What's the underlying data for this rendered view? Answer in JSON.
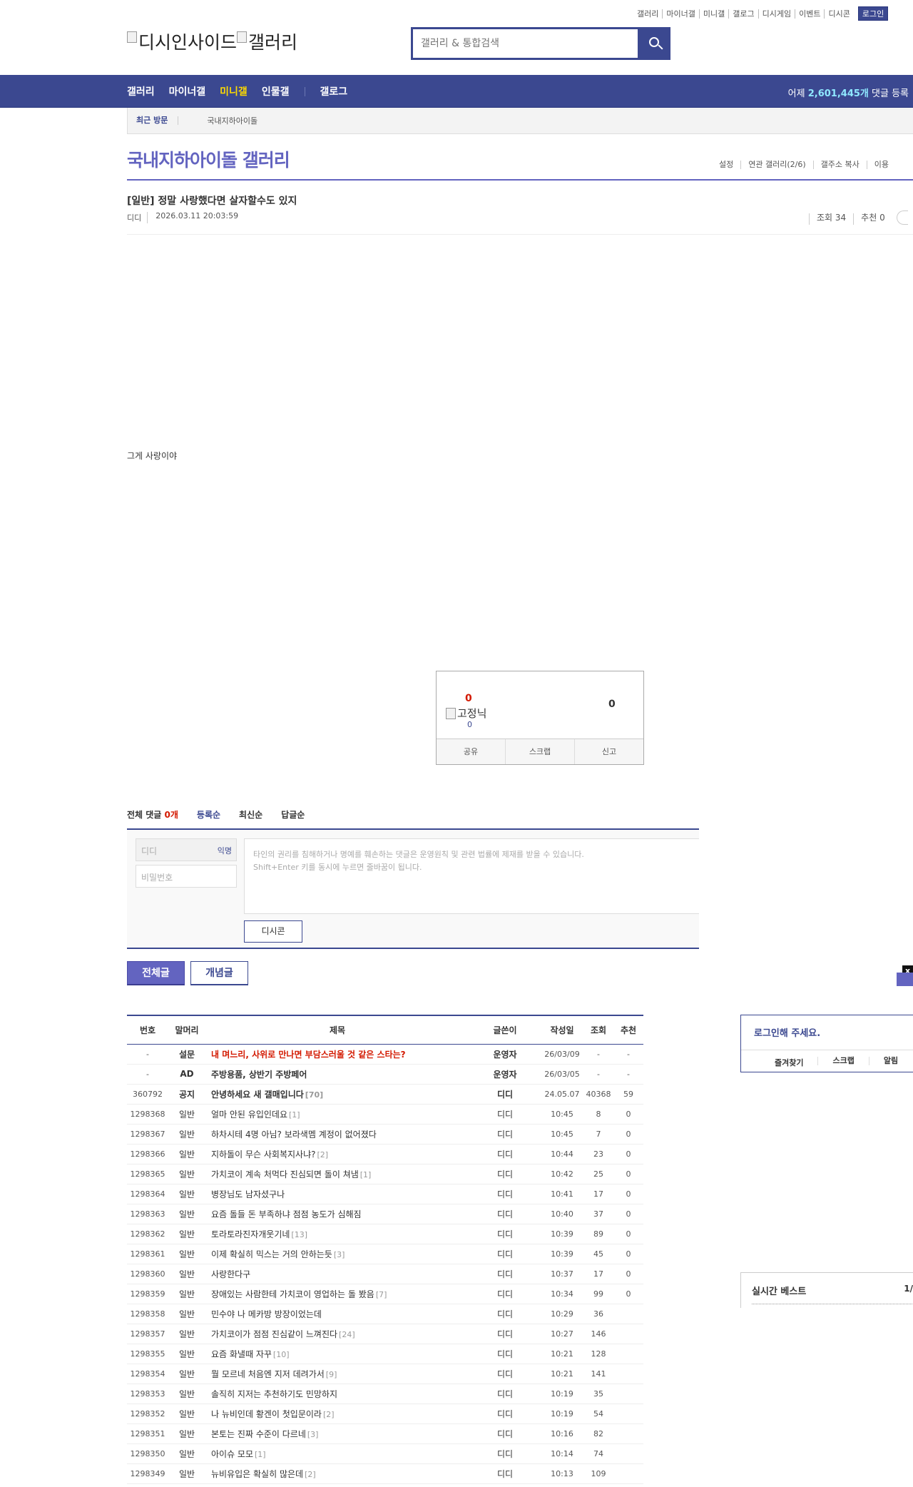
{
  "topnav": [
    "갤러리",
    "마이너갤",
    "미니갤",
    "갤로그",
    "디시게임",
    "이벤트",
    "디시콘"
  ],
  "login_label": "로그인",
  "logo": {
    "text1": "디시인사이드",
    "text2": "갤러리"
  },
  "search": {
    "placeholder": "갤러리 & 통합검색"
  },
  "gnb": {
    "items": [
      "갤러리",
      "마이너갤",
      "미니갤",
      "인물갤"
    ],
    "gallog": "갤로그",
    "stat_prefix": "어제 ",
    "stat_count": "2,601,445개",
    "stat_suffix": " 댓글 등록"
  },
  "visit": {
    "title": "최근 방문",
    "item": "국내지하아이돌"
  },
  "gallery": {
    "title": "국내지하아이돌 갤러리",
    "options": [
      "설정",
      "연관 갤러리(2/6)",
      "갤주소 복사",
      "이용"
    ]
  },
  "post": {
    "title": "[일반] 정말 사랑했다면 살자할수도 있지",
    "author": "디디",
    "date": "2026.03.11 20:03:59",
    "views": "조회 34",
    "recommend": "추천 0",
    "body": "그게 사랑이야"
  },
  "recommend_box": {
    "up": "0",
    "fixed": "고정닉",
    "fixed_count": "0",
    "down": "0",
    "share": "공유",
    "scrap": "스크랩",
    "report": "신고"
  },
  "comments": {
    "label": "전체 댓글",
    "count": "0개",
    "sort": [
      "등록순",
      "최신순",
      "답글순"
    ],
    "nick_placeholder": "디디",
    "anon": "익명",
    "pw_placeholder": "비밀번호",
    "notice1": "타인의 권리를 침해하거나 명예를 훼손하는 댓글은 운영원칙 및 관련 법률에 제재를 받을 수 있습니다.",
    "notice2": "Shift+Enter 키를 동시에 누르면 줄바꿈이 됩니다.",
    "dccon": "디시콘"
  },
  "buttons": {
    "all": "전체글",
    "concept": "개념글"
  },
  "close_x": "x",
  "table": {
    "headers": [
      "번호",
      "말머리",
      "제목",
      "글쓴이",
      "작성일",
      "조회",
      "추천"
    ],
    "rows": [
      {
        "num": "-",
        "head": "설문",
        "subject": "내 며느리, 사위로 만나면 부담스러울 것 같은 스타는?",
        "replies": "",
        "writer": "운영자",
        "date": "26/03/09",
        "views": "-",
        "rec": "-",
        "type": "red"
      },
      {
        "num": "-",
        "head": "AD",
        "subject": "주방용품, 상반기 주방페어",
        "replies": "",
        "writer": "운영자",
        "date": "26/03/05",
        "views": "-",
        "rec": "-",
        "type": "notice"
      },
      {
        "num": "360792",
        "head": "공지",
        "subject": "안녕하세요 새 갤매입니다",
        "replies": "[70]",
        "writer": "디디",
        "date": "24.05.07",
        "views": "40368",
        "rec": "59",
        "type": "notice"
      },
      {
        "num": "1298368",
        "head": "일반",
        "subject": "얼마 안된 유입인데요",
        "replies": "[1]",
        "writer": "디디",
        "date": "10:45",
        "views": "8",
        "rec": "0",
        "type": ""
      },
      {
        "num": "1298367",
        "head": "일반",
        "subject": "하차시테 4명 아님? 보라색멤 계정이 없어졌다",
        "replies": "",
        "writer": "디디",
        "date": "10:45",
        "views": "7",
        "rec": "0",
        "type": ""
      },
      {
        "num": "1298366",
        "head": "일반",
        "subject": "지하돌이 무슨 사회복지사냐?",
        "replies": "[2]",
        "writer": "디디",
        "date": "10:44",
        "views": "23",
        "rec": "0",
        "type": ""
      },
      {
        "num": "1298365",
        "head": "일반",
        "subject": "가치코이 계속 처먹다 진심되면 돌이 쳐냄",
        "replies": "[1]",
        "writer": "디디",
        "date": "10:42",
        "views": "25",
        "rec": "0",
        "type": ""
      },
      {
        "num": "1298364",
        "head": "일반",
        "subject": "병장님도 남자셨구나",
        "replies": "",
        "writer": "디디",
        "date": "10:41",
        "views": "17",
        "rec": "0",
        "type": ""
      },
      {
        "num": "1298363",
        "head": "일반",
        "subject": "요즘 돌들 돈 부족하냐 점점 농도가 심해짐",
        "replies": "",
        "writer": "디디",
        "date": "10:40",
        "views": "37",
        "rec": "0",
        "type": ""
      },
      {
        "num": "1298362",
        "head": "일반",
        "subject": "토라토라진자개웃기네",
        "replies": "[13]",
        "writer": "디디",
        "date": "10:39",
        "views": "89",
        "rec": "0",
        "type": ""
      },
      {
        "num": "1298361",
        "head": "일반",
        "subject": "이제 확실히 믹스는 거의 안하는듯",
        "replies": "[3]",
        "writer": "디디",
        "date": "10:39",
        "views": "45",
        "rec": "0",
        "type": ""
      },
      {
        "num": "1298360",
        "head": "일반",
        "subject": "사랑한다구",
        "replies": "",
        "writer": "디디",
        "date": "10:37",
        "views": "17",
        "rec": "0",
        "type": ""
      },
      {
        "num": "1298359",
        "head": "일반",
        "subject": "장애있는 사람한테 가치코이 영업하는 돌 봤음",
        "replies": "[7]",
        "writer": "디디",
        "date": "10:34",
        "views": "99",
        "rec": "0",
        "type": ""
      },
      {
        "num": "1298358",
        "head": "일반",
        "subject": "민수야 나 메카방 방장이었는데",
        "replies": "",
        "writer": "디디",
        "date": "10:29",
        "views": "36",
        "rec": "",
        "type": ""
      },
      {
        "num": "1298357",
        "head": "일반",
        "subject": "가치코이가 점점 진심같이 느껴진다",
        "replies": "[24]",
        "writer": "디디",
        "date": "10:27",
        "views": "146",
        "rec": "",
        "type": ""
      },
      {
        "num": "1298355",
        "head": "일반",
        "subject": "요즘 화낼때 자꾸",
        "replies": "[10]",
        "writer": "디디",
        "date": "10:21",
        "views": "128",
        "rec": "",
        "type": ""
      },
      {
        "num": "1298354",
        "head": "일반",
        "subject": "뭘 모르네 처음엔 지저 데려가서",
        "replies": "[9]",
        "writer": "디디",
        "date": "10:21",
        "views": "141",
        "rec": "",
        "type": ""
      },
      {
        "num": "1298353",
        "head": "일반",
        "subject": "솔직히 지저는 추천하기도 민망하지",
        "replies": "",
        "writer": "디디",
        "date": "10:19",
        "views": "35",
        "rec": "",
        "type": ""
      },
      {
        "num": "1298352",
        "head": "일반",
        "subject": "나 뉴비인데 황겐이 첫입문이라",
        "replies": "[2]",
        "writer": "디디",
        "date": "10:19",
        "views": "54",
        "rec": "",
        "type": ""
      },
      {
        "num": "1298351",
        "head": "일반",
        "subject": "본토는 진짜 수준이 다르네",
        "replies": "[3]",
        "writer": "디디",
        "date": "10:16",
        "views": "82",
        "rec": "",
        "type": ""
      },
      {
        "num": "1298350",
        "head": "일반",
        "subject": "아이슈 모모",
        "replies": "[1]",
        "writer": "디디",
        "date": "10:14",
        "views": "74",
        "rec": "",
        "type": ""
      },
      {
        "num": "1298349",
        "head": "일반",
        "subject": "뉴비유입은 확실히 많은데",
        "replies": "[2]",
        "writer": "디디",
        "date": "10:13",
        "views": "109",
        "rec": "",
        "type": ""
      }
    ]
  },
  "side": {
    "login_title": "로그인해 주세요.",
    "login_links": [
      "즐겨찾기",
      "스크랩",
      "알림"
    ],
    "realtime": "실시간 베스트",
    "page": "1/"
  }
}
